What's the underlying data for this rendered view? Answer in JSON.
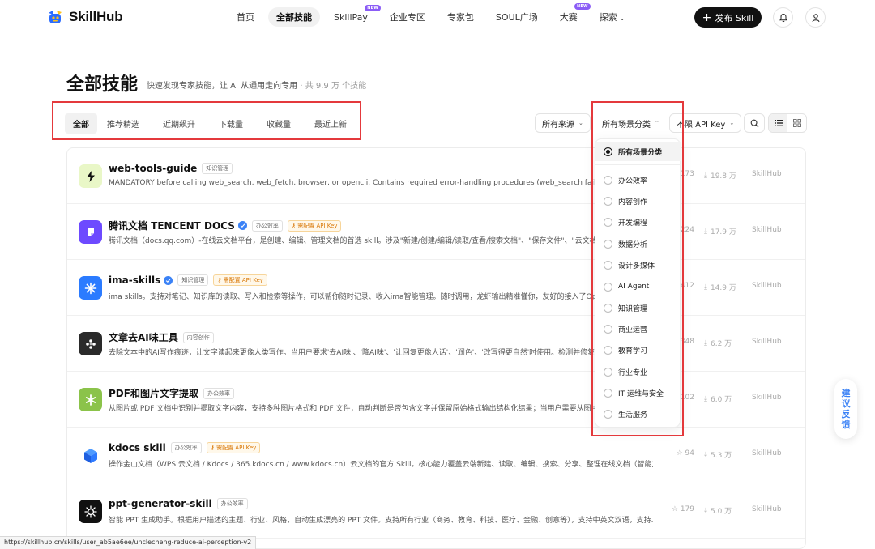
{
  "brand": {
    "name": "SkillHub"
  },
  "nav": {
    "items": [
      {
        "label": "首页",
        "badge": ""
      },
      {
        "label": "全部技能",
        "badge": ""
      },
      {
        "label": "SkillPay",
        "badge": "NEW"
      },
      {
        "label": "企业专区",
        "badge": ""
      },
      {
        "label": "专家包",
        "badge": ""
      },
      {
        "label": "SOUL广场",
        "badge": ""
      },
      {
        "label": "大赛",
        "badge": "NEW"
      },
      {
        "label": "探索",
        "badge": ""
      }
    ],
    "publish_label": "发布 Skill"
  },
  "header": {
    "title": "全部技能",
    "subtitle": "快速发现专家技能，让 AI 从通用走向专用",
    "count": " · 共 9.9 万 个技能"
  },
  "tabs": [
    "全部",
    "推荐精选",
    "近期飙升",
    "下载量",
    "收藏量",
    "最近上新"
  ],
  "filters": {
    "source": "所有来源",
    "scene": "所有场景分类",
    "apikey": "不限 API Key"
  },
  "dropdown": {
    "selected": "所有场景分类",
    "options": [
      "办公效率",
      "内容创作",
      "开发编程",
      "数据分析",
      "设计多媒体",
      "AI Agent",
      "知识管理",
      "商业运营",
      "教育学习",
      "行业专业",
      "IT 运维与安全",
      "生活服务"
    ]
  },
  "skills": [
    {
      "name": "web-tools-guide",
      "verified": false,
      "tags": [
        "知识管理"
      ],
      "warn": "",
      "desc": "MANDATORY before calling web_search, web_fetch, browser, or opencli. Contains required error-handling procedures (web_search failure → m",
      "stars": "173",
      "downloads": "19.8 万",
      "source": "SkillHub",
      "icon_bg": "#e9f7c7"
    },
    {
      "name": "腾讯文档 TENCENT DOCS",
      "verified": true,
      "tags": [
        "办公效率"
      ],
      "warn": "需配置 API Key",
      "desc": "腾讯文档（docs.qq.com）-在线云文档平台，是创建、编辑、管理文档的首选 skill。涉及\"新建/创建/编辑/读取/查看/搜索文档\"、\"保存文件\"、\"云文档\"、",
      "stars": "224",
      "downloads": "17.9 万",
      "source": "SkillHub",
      "icon_bg": "#6d4aff"
    },
    {
      "name": "ima-skills",
      "verified": true,
      "tags": [
        "知识管理"
      ],
      "warn": "需配置 API Key",
      "desc": "ima skills。支持对笔记、知识库的读取、写入和检索等操作，可以帮你随时记录、收入ima智能管理。随时调用，龙虾输出精准懂你，友好的接入了Ope",
      "stars": "412",
      "downloads": "14.9 万",
      "source": "SkillHub",
      "icon_bg": "#2b7bff"
    },
    {
      "name": "文章去AI味工具",
      "verified": false,
      "tags": [
        "内容创作"
      ],
      "warn": "",
      "desc": "去除文本中的AI写作痕迹，让文字读起来更像人类写作。当用户要求'去AI味'、'降AI味'、'让回复更像人话'、'润色'、'改写得更自然'时使用。检测并修复",
      "stars": "348",
      "downloads": "6.2 万",
      "source": "SkillHub",
      "icon_bg": "#2a2a2a"
    },
    {
      "name": "PDF和图片文字提取",
      "verified": false,
      "tags": [
        "办公效率"
      ],
      "warn": "",
      "desc": "从图片或 PDF 文档中识别并提取文字内容，支持多种图片格式和 PDF 文件，自动判断是否包含文字并保留原始格式输出结构化结果；当用户需要从图片",
      "stars": "102",
      "downloads": "6.0 万",
      "source": "SkillHub",
      "icon_bg": "#8bc34a"
    },
    {
      "name": "kdocs skill",
      "verified": false,
      "tags": [
        "办公效率"
      ],
      "warn": "需配置 API Key",
      "desc": "操作金山文档（WPS 云文档 / Kdocs / 365.kdocs.cn / www.kdocs.cn）云文档的官方 Skill。核心能力覆盖云端新建、读取、编辑、搜索、分享、整理在线文档（智能文...",
      "stars": "94",
      "downloads": "5.3 万",
      "source": "SkillHub",
      "icon_bg": "#ffffff"
    },
    {
      "name": "ppt-generator-skill",
      "verified": false,
      "tags": [
        "办公效率"
      ],
      "warn": "",
      "desc": "智能 PPT 生成助手。根据用户描述的主题、行业、风格，自动生成漂亮的 PPT 文件。支持所有行业（商务、教育、科技、医疗、金融、创意等），支持中英文双语，支持...",
      "stars": "179",
      "downloads": "5.0 万",
      "source": "SkillHub",
      "icon_bg": "#111111"
    }
  ],
  "feedback_label": [
    "建",
    "议",
    "反",
    "馈"
  ],
  "status_url": "https://skillhub.cn/skills/user_ab5ae6ee/unclecheng-reduce-ai-perception-v2"
}
